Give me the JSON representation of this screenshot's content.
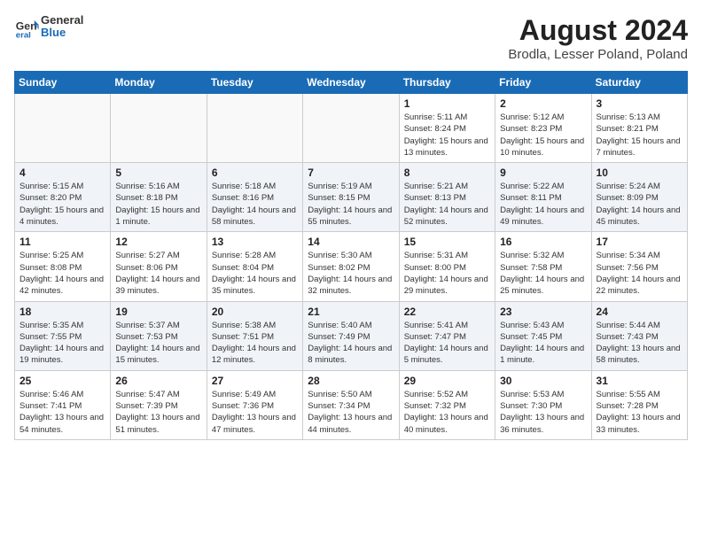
{
  "header": {
    "logo_line1": "General",
    "logo_line2": "Blue",
    "title": "August 2024",
    "subtitle": "Brodla, Lesser Poland, Poland"
  },
  "days_of_week": [
    "Sunday",
    "Monday",
    "Tuesday",
    "Wednesday",
    "Thursday",
    "Friday",
    "Saturday"
  ],
  "weeks": [
    [
      {
        "day": "",
        "info": ""
      },
      {
        "day": "",
        "info": ""
      },
      {
        "day": "",
        "info": ""
      },
      {
        "day": "",
        "info": ""
      },
      {
        "day": "1",
        "info": "Sunrise: 5:11 AM\nSunset: 8:24 PM\nDaylight: 15 hours\nand 13 minutes."
      },
      {
        "day": "2",
        "info": "Sunrise: 5:12 AM\nSunset: 8:23 PM\nDaylight: 15 hours\nand 10 minutes."
      },
      {
        "day": "3",
        "info": "Sunrise: 5:13 AM\nSunset: 8:21 PM\nDaylight: 15 hours\nand 7 minutes."
      }
    ],
    [
      {
        "day": "4",
        "info": "Sunrise: 5:15 AM\nSunset: 8:20 PM\nDaylight: 15 hours\nand 4 minutes."
      },
      {
        "day": "5",
        "info": "Sunrise: 5:16 AM\nSunset: 8:18 PM\nDaylight: 15 hours\nand 1 minute."
      },
      {
        "day": "6",
        "info": "Sunrise: 5:18 AM\nSunset: 8:16 PM\nDaylight: 14 hours\nand 58 minutes."
      },
      {
        "day": "7",
        "info": "Sunrise: 5:19 AM\nSunset: 8:15 PM\nDaylight: 14 hours\nand 55 minutes."
      },
      {
        "day": "8",
        "info": "Sunrise: 5:21 AM\nSunset: 8:13 PM\nDaylight: 14 hours\nand 52 minutes."
      },
      {
        "day": "9",
        "info": "Sunrise: 5:22 AM\nSunset: 8:11 PM\nDaylight: 14 hours\nand 49 minutes."
      },
      {
        "day": "10",
        "info": "Sunrise: 5:24 AM\nSunset: 8:09 PM\nDaylight: 14 hours\nand 45 minutes."
      }
    ],
    [
      {
        "day": "11",
        "info": "Sunrise: 5:25 AM\nSunset: 8:08 PM\nDaylight: 14 hours\nand 42 minutes."
      },
      {
        "day": "12",
        "info": "Sunrise: 5:27 AM\nSunset: 8:06 PM\nDaylight: 14 hours\nand 39 minutes."
      },
      {
        "day": "13",
        "info": "Sunrise: 5:28 AM\nSunset: 8:04 PM\nDaylight: 14 hours\nand 35 minutes."
      },
      {
        "day": "14",
        "info": "Sunrise: 5:30 AM\nSunset: 8:02 PM\nDaylight: 14 hours\nand 32 minutes."
      },
      {
        "day": "15",
        "info": "Sunrise: 5:31 AM\nSunset: 8:00 PM\nDaylight: 14 hours\nand 29 minutes."
      },
      {
        "day": "16",
        "info": "Sunrise: 5:32 AM\nSunset: 7:58 PM\nDaylight: 14 hours\nand 25 minutes."
      },
      {
        "day": "17",
        "info": "Sunrise: 5:34 AM\nSunset: 7:56 PM\nDaylight: 14 hours\nand 22 minutes."
      }
    ],
    [
      {
        "day": "18",
        "info": "Sunrise: 5:35 AM\nSunset: 7:55 PM\nDaylight: 14 hours\nand 19 minutes."
      },
      {
        "day": "19",
        "info": "Sunrise: 5:37 AM\nSunset: 7:53 PM\nDaylight: 14 hours\nand 15 minutes."
      },
      {
        "day": "20",
        "info": "Sunrise: 5:38 AM\nSunset: 7:51 PM\nDaylight: 14 hours\nand 12 minutes."
      },
      {
        "day": "21",
        "info": "Sunrise: 5:40 AM\nSunset: 7:49 PM\nDaylight: 14 hours\nand 8 minutes."
      },
      {
        "day": "22",
        "info": "Sunrise: 5:41 AM\nSunset: 7:47 PM\nDaylight: 14 hours\nand 5 minutes."
      },
      {
        "day": "23",
        "info": "Sunrise: 5:43 AM\nSunset: 7:45 PM\nDaylight: 14 hours\nand 1 minute."
      },
      {
        "day": "24",
        "info": "Sunrise: 5:44 AM\nSunset: 7:43 PM\nDaylight: 13 hours\nand 58 minutes."
      }
    ],
    [
      {
        "day": "25",
        "info": "Sunrise: 5:46 AM\nSunset: 7:41 PM\nDaylight: 13 hours\nand 54 minutes."
      },
      {
        "day": "26",
        "info": "Sunrise: 5:47 AM\nSunset: 7:39 PM\nDaylight: 13 hours\nand 51 minutes."
      },
      {
        "day": "27",
        "info": "Sunrise: 5:49 AM\nSunset: 7:36 PM\nDaylight: 13 hours\nand 47 minutes."
      },
      {
        "day": "28",
        "info": "Sunrise: 5:50 AM\nSunset: 7:34 PM\nDaylight: 13 hours\nand 44 minutes."
      },
      {
        "day": "29",
        "info": "Sunrise: 5:52 AM\nSunset: 7:32 PM\nDaylight: 13 hours\nand 40 minutes."
      },
      {
        "day": "30",
        "info": "Sunrise: 5:53 AM\nSunset: 7:30 PM\nDaylight: 13 hours\nand 36 minutes."
      },
      {
        "day": "31",
        "info": "Sunrise: 5:55 AM\nSunset: 7:28 PM\nDaylight: 13 hours\nand 33 minutes."
      }
    ]
  ]
}
